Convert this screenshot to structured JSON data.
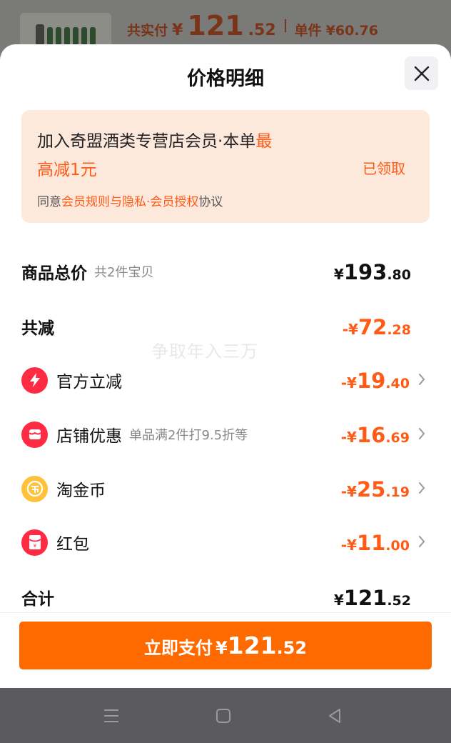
{
  "background": {
    "summary_label": "共实付",
    "currency": "¥",
    "total_int": "121",
    "total_dec": ".52",
    "unit_label": "单件",
    "unit_price": "¥60.76"
  },
  "sheet": {
    "title": "价格明细",
    "close_icon": "close-icon"
  },
  "promo": {
    "line1_text": "加入奇盟酒类专营店会员·本单",
    "line1_highlight": "最",
    "line2": "高减1元",
    "claim_label": "已领取",
    "agree_prefix": "同意",
    "agree_link": "会员规则与隐私·会员授权",
    "agree_suffix": "协议"
  },
  "rows": {
    "total_price": {
      "label": "商品总价",
      "sub": "共2件宝贝",
      "sign": "¥",
      "int": "193",
      "dec": ".80"
    },
    "discount_total": {
      "label": "共减",
      "sign": "-¥",
      "int": "72",
      "dec": ".28"
    },
    "official": {
      "label": "官方立减",
      "icon": "lightning-icon",
      "sign": "-¥",
      "int": "19",
      "dec": ".40"
    },
    "store": {
      "label": "店铺优惠",
      "sub": "单品满2件打9.5折等",
      "icon": "store-icon",
      "sign": "-¥",
      "int": "16",
      "dec": ".69"
    },
    "coin": {
      "label": "淘金币",
      "icon": "coin-icon",
      "sign": "-¥",
      "int": "25",
      "dec": ".19"
    },
    "redpacket": {
      "label": "红包",
      "icon": "red-packet-icon",
      "sign": "-¥",
      "int": "11",
      "dec": ".00"
    },
    "sum": {
      "label": "合计",
      "sign": "¥",
      "int": "121",
      "dec": ".52"
    }
  },
  "watermark": "争取年入三万",
  "pay_button": {
    "label": "立即支付",
    "sign": "¥",
    "int": "121",
    "dec": ".52"
  },
  "colors": {
    "accent": "#ff6a00",
    "orange_text": "#ff5a16",
    "promo_bg": "#fde8dc",
    "icon_red": "#ff2b42",
    "icon_gold": "#ffc23a"
  },
  "navbar": {
    "menu_icon": "menu-icon",
    "home_icon": "home-icon",
    "back_icon": "back-icon"
  }
}
